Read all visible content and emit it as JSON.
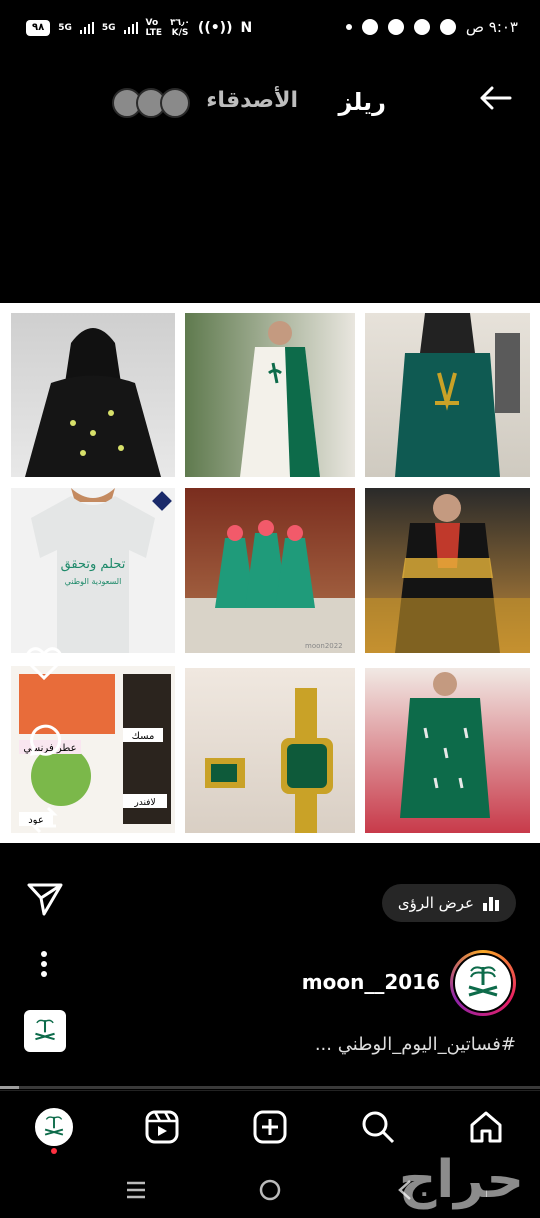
{
  "status_bar": {
    "battery": "٩٨",
    "network_1": "5G",
    "network_2": "5G",
    "volte": "Vo\nLTE",
    "speed": "٣٦٫٠\nK/S",
    "time": "٩:٠٣ ص"
  },
  "header": {
    "title": "ريلز",
    "friends": "الأصدقاء"
  },
  "post_grid": {
    "tile_texts": {
      "shirt_line1": "تحلم وتحقق",
      "shirt_line2": "السعودية الوطني",
      "watermark_text": "moon2022",
      "label_perfume": "عطر فرنسي",
      "label_musk": "مسك",
      "label_lavender": "لافندر",
      "label_oud": "عود"
    }
  },
  "actions": {
    "insights_label": "عرض الرؤى"
  },
  "post_info": {
    "username": "moon__2016",
    "caption": "#فساتين_اليوم_الوطني ..."
  },
  "progress": {
    "fraction": 0.035
  },
  "colors": {
    "accent_green": "#0d6b4a",
    "gold": "#c9a227",
    "notify_red": "#ff3040"
  },
  "watermark": "حراج"
}
